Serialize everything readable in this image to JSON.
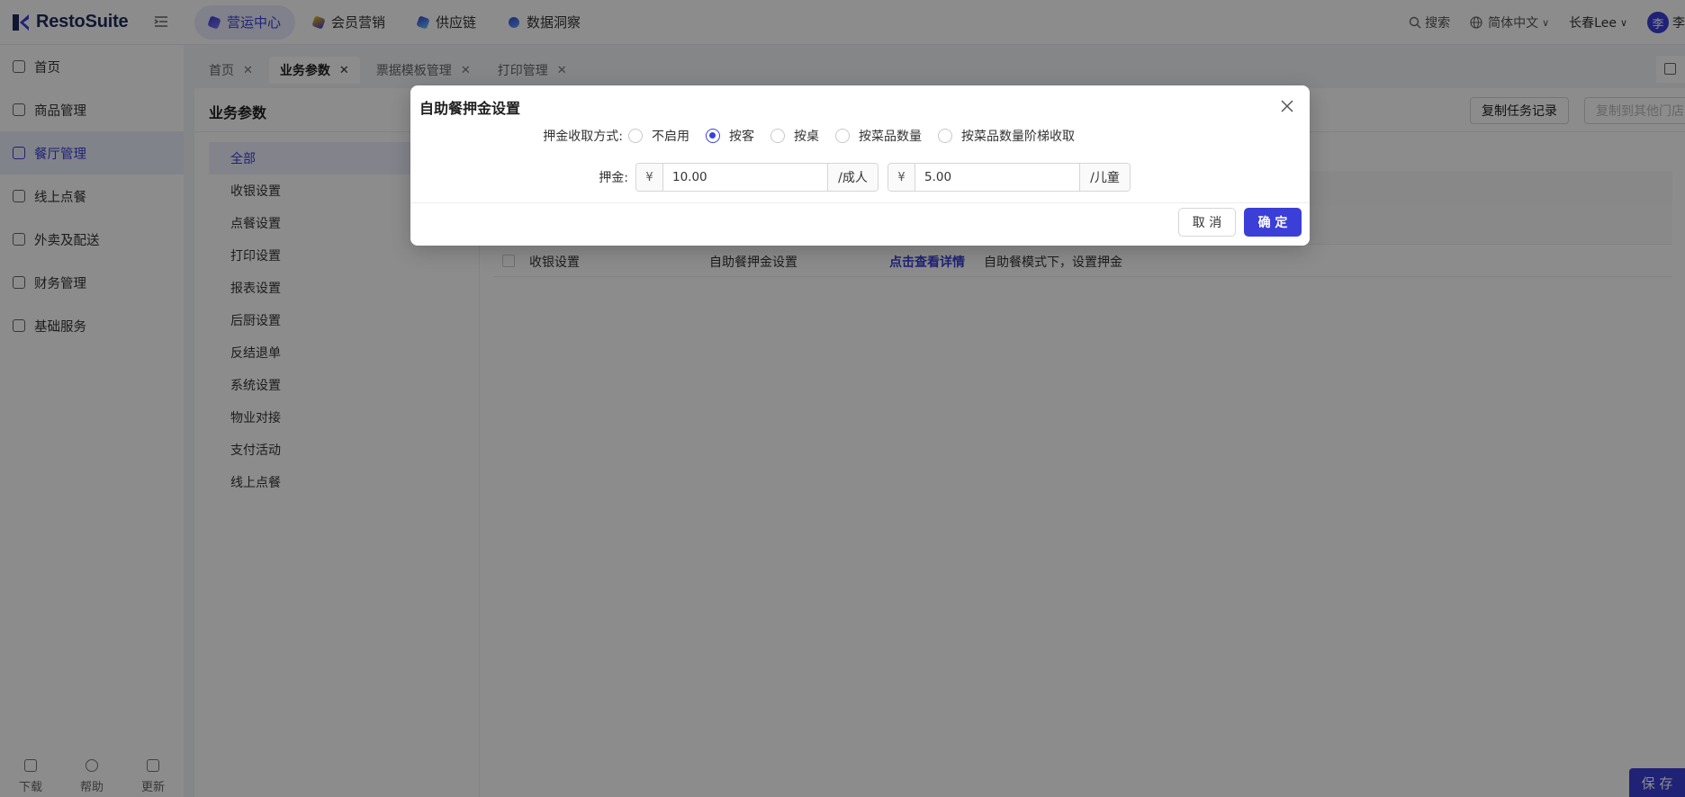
{
  "brand": {
    "name": "RestoSuite",
    "accent": "#3b3fd8"
  },
  "topnav": {
    "items": [
      {
        "label": "营运中心",
        "active": true
      },
      {
        "label": "会员营销",
        "active": false
      },
      {
        "label": "供应链",
        "active": false
      },
      {
        "label": "数据洞察",
        "active": false
      }
    ],
    "search": "搜索",
    "language": "简体中文",
    "store": "长春Lee",
    "avatar_char": "李",
    "user_short": "李"
  },
  "sidebar": {
    "items": [
      {
        "label": "首页"
      },
      {
        "label": "商品管理"
      },
      {
        "label": "餐厅管理",
        "active": true
      },
      {
        "label": "线上点餐"
      },
      {
        "label": "外卖及配送"
      },
      {
        "label": "财务管理"
      },
      {
        "label": "基础服务"
      }
    ],
    "bottom": [
      {
        "label": "下载"
      },
      {
        "label": "帮助"
      },
      {
        "label": "更新"
      }
    ]
  },
  "tabs": [
    {
      "label": "首页"
    },
    {
      "label": "业务参数",
      "active": true
    },
    {
      "label": "票据模板管理"
    },
    {
      "label": "打印管理"
    }
  ],
  "content": {
    "title": "业务参数",
    "buttons": {
      "copy_record": "复制任务记录",
      "copy_to_store": "复制到其他门店"
    },
    "categories": [
      {
        "label": "全部",
        "active": true
      },
      {
        "label": "收银设置"
      },
      {
        "label": "点餐设置"
      },
      {
        "label": "打印设置"
      },
      {
        "label": "报表设置"
      },
      {
        "label": "后厨设置"
      },
      {
        "label": "反结退单"
      },
      {
        "label": "系统设置"
      },
      {
        "label": "物业对接"
      },
      {
        "label": "支付活动"
      },
      {
        "label": "线上点餐"
      }
    ],
    "row": {
      "category": "收银设置",
      "name": "自助餐押金设置",
      "link": "点击查看详情",
      "desc": "自助餐模式下，设置押金"
    },
    "save": "保 存"
  },
  "modal": {
    "title": "自助餐押金设置",
    "method_label": "押金收取方式:",
    "options": [
      {
        "label": "不启用",
        "selected": false
      },
      {
        "label": "按客",
        "selected": true
      },
      {
        "label": "按桌",
        "selected": false
      },
      {
        "label": "按菜品数量",
        "selected": false
      },
      {
        "label": "按菜品数量阶梯收取",
        "selected": false
      }
    ],
    "deposit_label": "押金:",
    "adult": {
      "prefix": "¥",
      "value": "10.00",
      "suffix": "/成人"
    },
    "child": {
      "prefix": "¥",
      "value": "5.00",
      "suffix": "/儿童"
    },
    "cancel": "取 消",
    "ok": "确 定"
  }
}
